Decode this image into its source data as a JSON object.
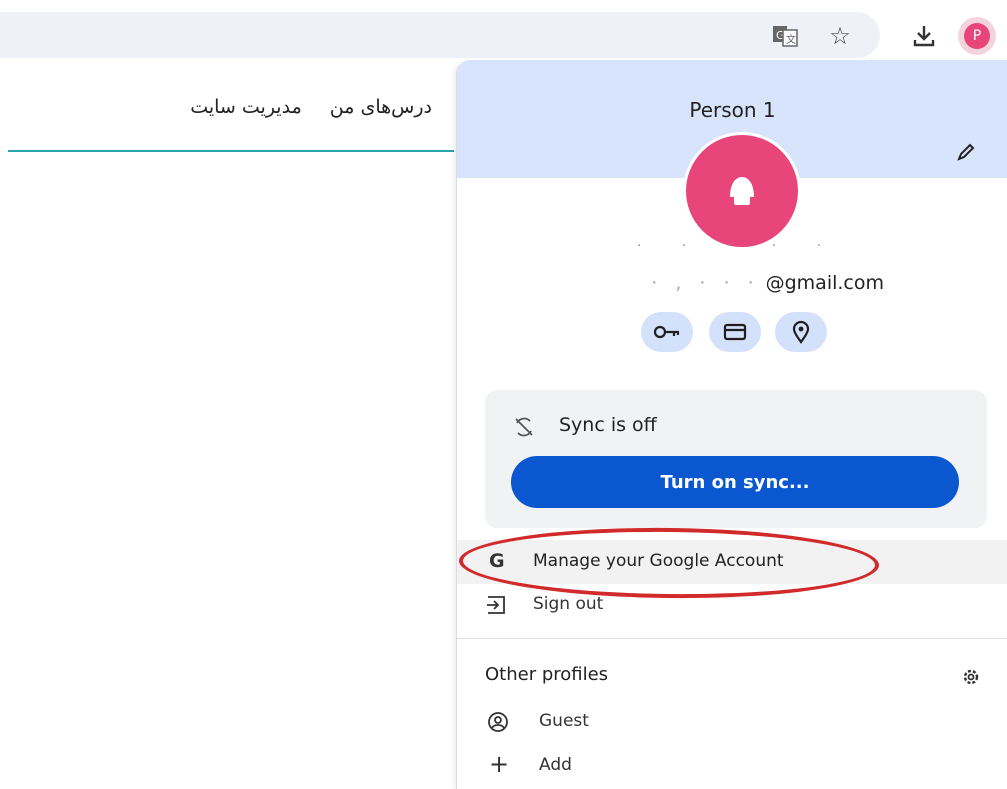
{
  "toolbar": {
    "icons": [
      "translate-icon",
      "star-icon",
      "download-icon"
    ],
    "avatar_letter": "P"
  },
  "page_nav": {
    "items": [
      "درس‌های من",
      "مدیریت سایت"
    ]
  },
  "profile_menu": {
    "person_name": "Person 1",
    "email_suffix": "@gmail.com",
    "quick_actions": [
      "key-icon",
      "credit-card-icon",
      "location-pin-icon"
    ],
    "sync": {
      "status": "Sync is off",
      "button_label": "Turn on sync..."
    },
    "manage_account_label": "Manage your Google Account",
    "sign_out_label": "Sign out",
    "other_profiles": {
      "title": "Other profiles",
      "guest_label": "Guest",
      "add_label": "Add"
    },
    "colors": {
      "header_bg": "#d8e4fb",
      "avatar": "#e8457a",
      "sync_button": "#0b57d0",
      "highlight": "#d12a2a"
    }
  }
}
